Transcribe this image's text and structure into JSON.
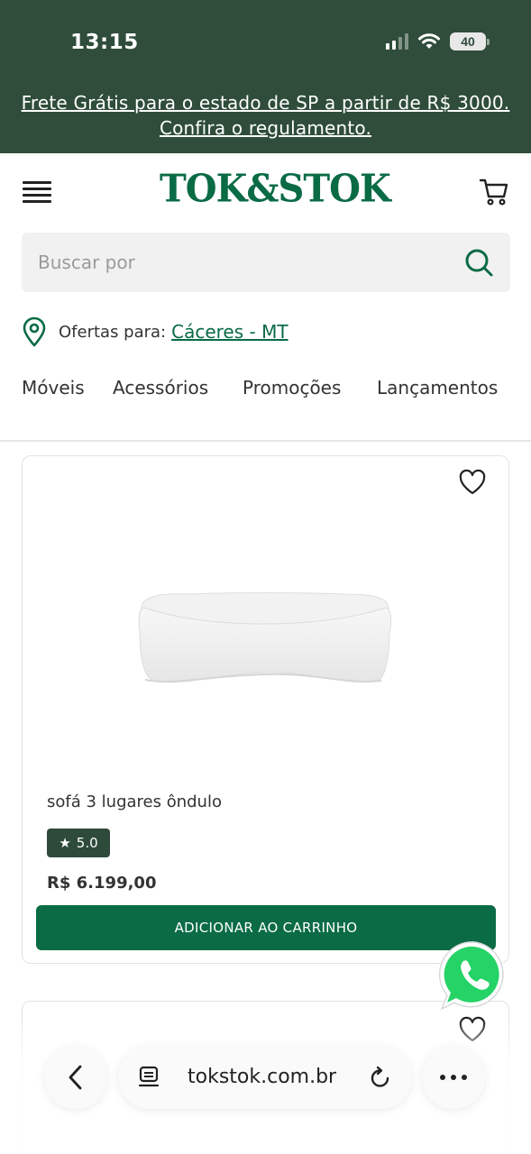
{
  "status_bar": {
    "time": "13:15",
    "battery": "40"
  },
  "promo_banner": {
    "line1": "Frete Grátis para o estado de SP a partir de R$ 3000.",
    "line2": "Confira o regulamento."
  },
  "header": {
    "logo": "TOK&STOK",
    "menu_icon": "hamburger-icon",
    "cart_icon": "cart-icon"
  },
  "search": {
    "placeholder": "Buscar por",
    "value": ""
  },
  "location": {
    "label": "Ofertas para:",
    "city": "Cáceres - MT"
  },
  "nav": {
    "items": [
      "Móveis",
      "Acessórios",
      "Promoções",
      "Lançamentos"
    ]
  },
  "product": {
    "name": "sofá 3 lugares ôndulo",
    "rating": "5.0",
    "price": "R$ 6.199,00",
    "add_button": "ADICIONAR AO CARRINHO"
  },
  "browser": {
    "url": "tokstok.com.br"
  },
  "colors": {
    "brand_green": "#0a6b45",
    "banner_green": "#2f4d3a",
    "rating_bg": "#2e4a3b",
    "whatsapp": "#25d366"
  }
}
